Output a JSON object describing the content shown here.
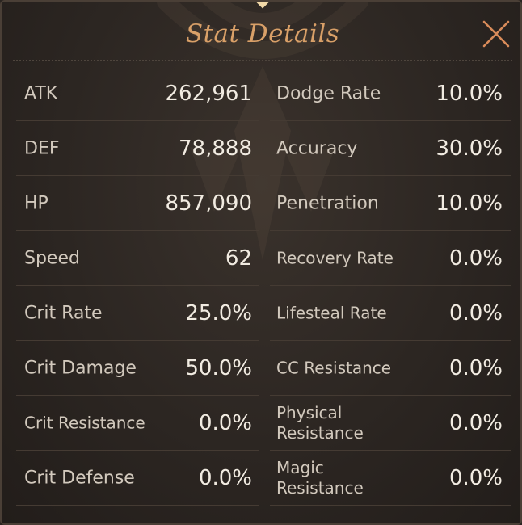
{
  "title": "Stat Details",
  "icons": {
    "close": "close-icon",
    "emblem": "crest-emblem-icon",
    "gem": "diamond-gem-icon"
  },
  "colors": {
    "title": "#d9a068",
    "label": "#d2c9bd",
    "value": "#f1ebe1",
    "divider": "#453b33",
    "close": "#d98b5a"
  },
  "left_stats": [
    {
      "label": "ATK",
      "value": "262,961"
    },
    {
      "label": "DEF",
      "value": "78,888"
    },
    {
      "label": "HP",
      "value": "857,090"
    },
    {
      "label": "Speed",
      "value": "62"
    },
    {
      "label": "Crit Rate",
      "value": "25.0%"
    },
    {
      "label": "Crit Damage",
      "value": "50.0%"
    },
    {
      "label": "Crit Resistance",
      "value": "0.0%"
    },
    {
      "label": "Crit Defense",
      "value": "0.0%"
    }
  ],
  "right_stats": [
    {
      "label": "Dodge Rate",
      "value": "10.0%"
    },
    {
      "label": "Accuracy",
      "value": "30.0%"
    },
    {
      "label": "Penetration",
      "value": "10.0%"
    },
    {
      "label": "Recovery Rate",
      "value": "0.0%"
    },
    {
      "label": "Lifesteal Rate",
      "value": "0.0%"
    },
    {
      "label": "CC Resistance",
      "value": "0.0%"
    },
    {
      "label_line1": "Physical",
      "label_line2": "Resistance",
      "value": "0.0%"
    },
    {
      "label_line1": "Magic",
      "label_line2": "Resistance",
      "value": "0.0%"
    }
  ]
}
